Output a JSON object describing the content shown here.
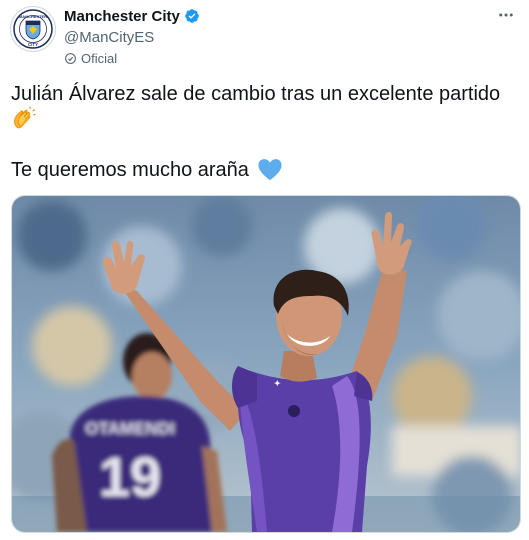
{
  "account": {
    "display_name": "Manchester City",
    "handle": "@ManCityES",
    "label": "Oficial",
    "avatar_text": {
      "top": "MANCHESTER",
      "bottom": "CITY"
    }
  },
  "tweet": {
    "line1": "Julián Álvarez sale de cambio tras un excelente partido",
    "line1_emoji": "clapping-hands",
    "line2": "Te queremos mucho araña",
    "line2_emoji": "blue-heart"
  },
  "media": {
    "jersey_name": "OTAMENDI",
    "jersey_number": "19"
  },
  "colors": {
    "text": "#0f1419",
    "secondary": "#536471",
    "verified": "#1d9bf0",
    "kit_purple": "#5b3fa8"
  }
}
